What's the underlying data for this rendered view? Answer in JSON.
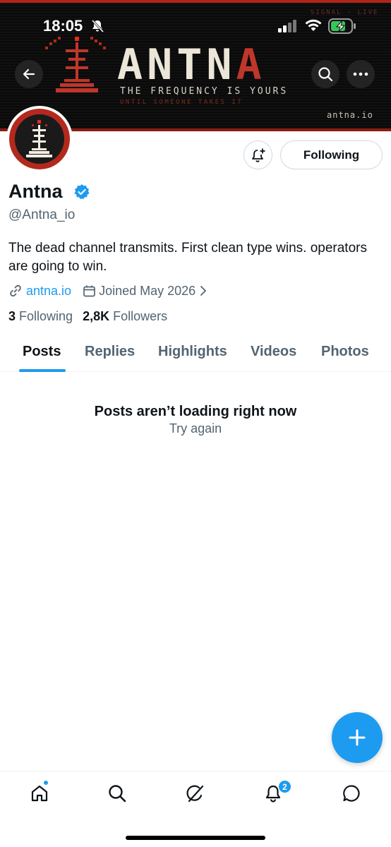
{
  "status_bar": {
    "time": "18:05",
    "icons": [
      "bell-muted-icon",
      "cellular-signal-icon",
      "wifi-icon",
      "battery-charging-icon"
    ]
  },
  "banner": {
    "signal_text": "SIGNAL · LIVE",
    "logo_main": "ANTN",
    "logo_accent": "A",
    "tagline": "THE FREQUENCY IS YOURS",
    "subtag": "UNTIL SOMEONE TAKES IT",
    "url": "antna.io"
  },
  "nav": {
    "icons": [
      "back-arrow-icon",
      "search-icon",
      "more-icon"
    ]
  },
  "profile": {
    "display_name": "Antna",
    "handle": "@Antna_io",
    "bio": "The dead channel transmits. First clean type wins. operators are going to win.",
    "link": "antna.io",
    "joined": "Joined May 2026",
    "following_count": "3",
    "following_label": "Following",
    "followers_count": "2,8K",
    "followers_label": "Followers"
  },
  "actions": {
    "following_button": "Following",
    "notify_icon": "bell-plus-icon"
  },
  "tabs": [
    {
      "label": "Posts",
      "active": true
    },
    {
      "label": "Replies",
      "active": false
    },
    {
      "label": "Highlights",
      "active": false
    },
    {
      "label": "Videos",
      "active": false
    },
    {
      "label": "Photos",
      "active": false
    }
  ],
  "empty_state": {
    "title": "Posts aren’t loading right now",
    "action": "Try again"
  },
  "bottom_nav": {
    "items": [
      "home-icon",
      "search-icon",
      "grok-icon",
      "notifications-icon",
      "messages-icon"
    ],
    "notification_badge": "2"
  },
  "colors": {
    "accent": "#1d9bf0",
    "text_primary": "#0f1419",
    "text_secondary": "#536471",
    "banner_red": "#c0362a"
  }
}
